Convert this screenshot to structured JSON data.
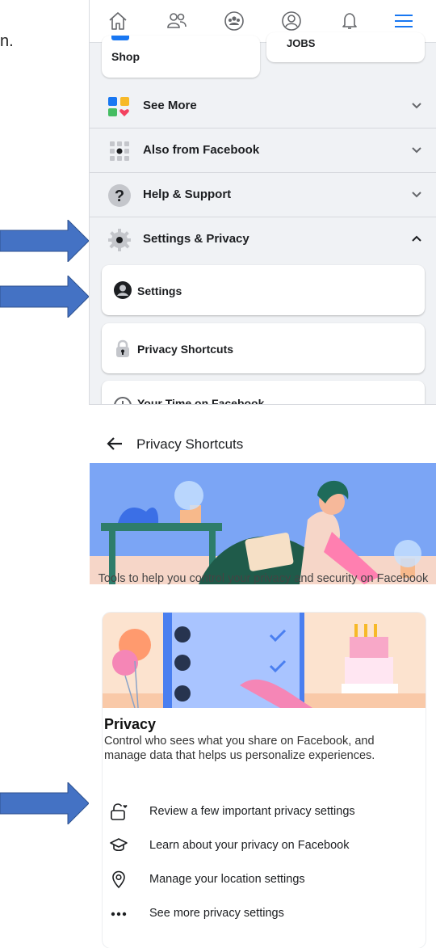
{
  "fragment": "n.",
  "nav": {
    "icons": [
      "home-icon",
      "friends-icon",
      "groups-icon",
      "profile-icon",
      "notifications-icon",
      "menu-icon"
    ],
    "active_color": "#1877f2"
  },
  "shortcut_cards": {
    "shop": "Shop",
    "jobs": "Jobs"
  },
  "menu": {
    "see_more": "See More",
    "also_from_facebook": "Also from Facebook",
    "help_support": "Help & Support",
    "settings_privacy": "Settings & Privacy"
  },
  "submenu": {
    "settings": "Settings",
    "privacy_shortcuts": "Privacy Shortcuts",
    "your_time": "Your Time on Facebook"
  },
  "privacy_page": {
    "title": "Privacy Shortcuts",
    "tagline": "Tools to help you control your privacy and security on Facebook",
    "section_title": "Privacy",
    "section_desc": "Control who sees what you share on Facebook, and manage data that helps us personalize experiences.",
    "items": [
      {
        "label": "Review a few important privacy settings",
        "icon": "lock-heart-icon"
      },
      {
        "label": "Learn about your privacy on Facebook",
        "icon": "graduation-cap-icon"
      },
      {
        "label": "Manage your location settings",
        "icon": "location-pin-icon"
      },
      {
        "label": "See more privacy settings",
        "icon": "more-dots-icon"
      }
    ]
  },
  "colors": {
    "arrow": "#4472c4",
    "fb_blue": "#1877f2",
    "menu_bg": "#f0f2f5"
  }
}
